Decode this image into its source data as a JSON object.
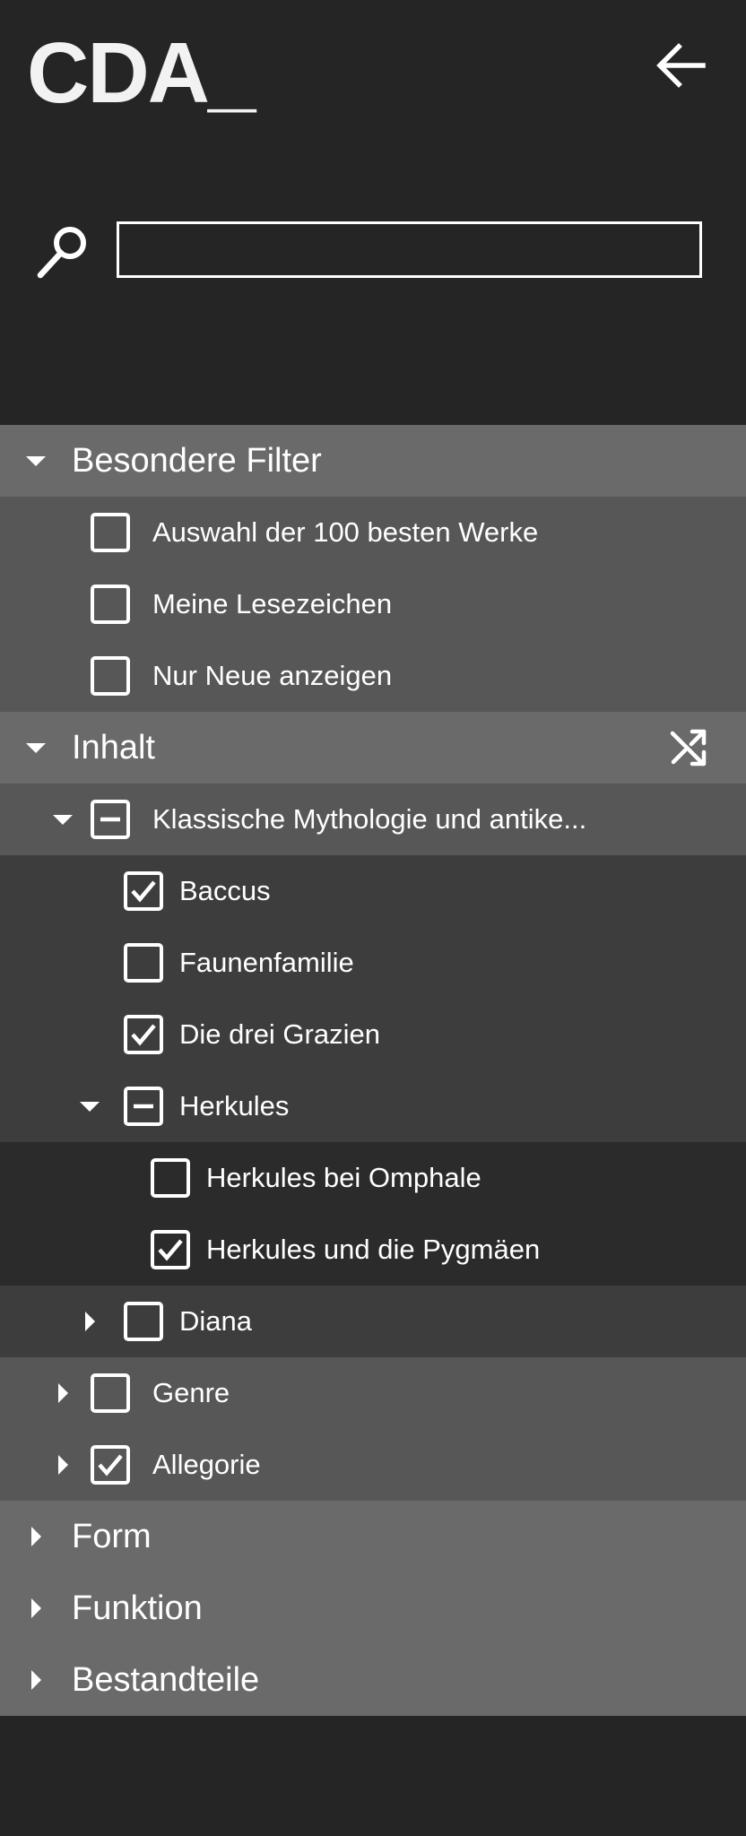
{
  "header": {
    "logo": "CDA_",
    "back_icon": "arrow-left-icon"
  },
  "search": {
    "value": "",
    "placeholder": "",
    "icon": "search-icon"
  },
  "filters": {
    "special": {
      "title": "Besondere Filter",
      "expanded": true,
      "items": [
        {
          "label": "Auswahl der 100 besten Werke",
          "checked": false
        },
        {
          "label": "Meine Lesezeichen",
          "checked": false
        },
        {
          "label": "Nur Neue anzeigen",
          "checked": false
        }
      ]
    },
    "content": {
      "title": "Inhalt",
      "expanded": true,
      "shuffle_icon": "shuffle-icon",
      "mythology": {
        "label": "Klassische Mythologie und antike...",
        "state": "partial",
        "expanded": true,
        "children": [
          {
            "label": "Baccus",
            "checked": true
          },
          {
            "label": "Faunenfamilie",
            "checked": false
          },
          {
            "label": "Die drei Grazien",
            "checked": true
          }
        ],
        "herkules": {
          "label": "Herkules",
          "state": "partial",
          "expanded": true,
          "children": [
            {
              "label": "Herkules bei Omphale",
              "checked": false
            },
            {
              "label": "Herkules und die Pygmäen",
              "checked": true
            }
          ]
        },
        "diana": {
          "label": "Diana",
          "checked": false,
          "expanded": false
        }
      },
      "genre": {
        "label": "Genre",
        "checked": false,
        "expanded": false
      },
      "allegorie": {
        "label": "Allegorie",
        "checked": true,
        "expanded": false
      }
    },
    "form": {
      "title": "Form",
      "expanded": false
    },
    "function": {
      "title": "Funktion",
      "expanded": false
    },
    "parts": {
      "title": "Bestandteile",
      "expanded": false
    }
  },
  "colors": {
    "background": "#252525",
    "section_row": "#6a6a6a",
    "level1_row": "#575757",
    "level2_row": "#3d3d3d",
    "level3_row": "#2b2b2b",
    "foreground": "#ffffff"
  }
}
